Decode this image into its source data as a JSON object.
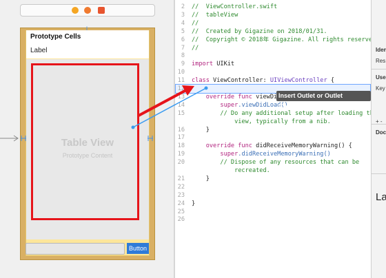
{
  "storyboard": {
    "cell_section_title": "Prototype Cells",
    "cell_label": "Label",
    "table_view_title": "Table View",
    "table_view_subtitle": "Prototype Content",
    "button_label": "Button"
  },
  "editor": {
    "lines": [
      {
        "num": "2",
        "segments": [
          {
            "t": "//  ViewController.swift",
            "c": "comment"
          }
        ]
      },
      {
        "num": "3",
        "segments": [
          {
            "t": "//  tableView",
            "c": "comment"
          }
        ]
      },
      {
        "num": "4",
        "segments": [
          {
            "t": "//",
            "c": "comment"
          }
        ]
      },
      {
        "num": "5",
        "segments": [
          {
            "t": "//  Created by Gigazine on 2018/01/31.",
            "c": "comment"
          }
        ]
      },
      {
        "num": "6",
        "segments": [
          {
            "t": "//  Copyright © 2018年 Gigazine. All rights reserved.",
            "c": "comment"
          }
        ]
      },
      {
        "num": "7",
        "segments": [
          {
            "t": "//",
            "c": "comment"
          }
        ]
      },
      {
        "num": "8",
        "segments": []
      },
      {
        "num": "9",
        "segments": [
          {
            "t": "import",
            "c": "kw"
          },
          {
            "t": " UIKit",
            "c": "plain"
          }
        ]
      },
      {
        "num": "10",
        "segments": []
      },
      {
        "num": "11",
        "segments": [
          {
            "t": "class",
            "c": "kw"
          },
          {
            "t": " ViewController: ",
            "c": "plain"
          },
          {
            "t": "UIViewController",
            "c": "type"
          },
          {
            "t": " {",
            "c": "plain"
          }
        ]
      },
      {
        "num": "12",
        "segments": []
      },
      {
        "num": "13",
        "segments": [
          {
            "t": "    override func",
            "c": "kw"
          },
          {
            "t": " viewDid",
            "c": "plain"
          }
        ]
      },
      {
        "num": "14",
        "segments": [
          {
            "t": "        super",
            "c": "kw"
          },
          {
            "t": ".viewDidLoad()",
            "c": "fn"
          }
        ]
      },
      {
        "num": "15",
        "segments": [
          {
            "t": "        // Do any additional setup after loading the",
            "c": "comment"
          }
        ]
      },
      {
        "num": "",
        "segments": [
          {
            "t": "            view, typically from a nib.",
            "c": "comment"
          }
        ]
      },
      {
        "num": "16",
        "segments": [
          {
            "t": "    }",
            "c": "plain"
          }
        ]
      },
      {
        "num": "17",
        "segments": []
      },
      {
        "num": "18",
        "segments": [
          {
            "t": "    override func",
            "c": "kw"
          },
          {
            "t": " didReceiveMemoryWarning() {",
            "c": "plain"
          }
        ]
      },
      {
        "num": "19",
        "segments": [
          {
            "t": "        super",
            "c": "kw"
          },
          {
            "t": ".didReceiveMemoryWarning()",
            "c": "fn"
          }
        ]
      },
      {
        "num": "20",
        "segments": [
          {
            "t": "        // Dispose of any resources that can be",
            "c": "comment"
          }
        ]
      },
      {
        "num": "",
        "segments": [
          {
            "t": "            recreated.",
            "c": "comment"
          }
        ]
      },
      {
        "num": "21",
        "segments": [
          {
            "t": "    }",
            "c": "plain"
          }
        ]
      },
      {
        "num": "22",
        "segments": []
      },
      {
        "num": "23",
        "segments": []
      },
      {
        "num": "24",
        "segments": [
          {
            "t": "}",
            "c": "plain"
          }
        ]
      },
      {
        "num": "25",
        "segments": []
      },
      {
        "num": "26",
        "segments": []
      }
    ],
    "tooltip": "Insert Outlet or Outlet Collection"
  },
  "inspector": {
    "ident_label": "Iden",
    "res_label": "Res",
    "user_label": "User",
    "key_label": "Key",
    "plus_minus": "+ -",
    "doc_label": "Docu",
    "large_label": "La"
  },
  "icons": {
    "entry_arrow": "arrow-right-icon",
    "view_controller": "view-controller-icon",
    "first_responder": "first-responder-icon",
    "exit": "exit-icon"
  },
  "colors": {
    "selection_red": "#e6141a",
    "connection_blue": "#3a9bf0",
    "scene_yellow": "#fde69a"
  }
}
